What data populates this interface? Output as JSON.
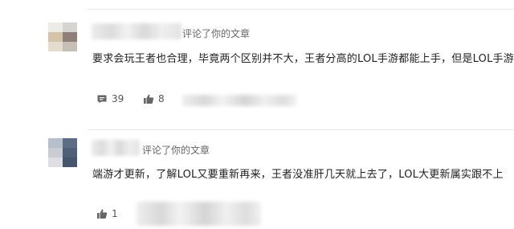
{
  "comments": [
    {
      "action": "评论了你的文章",
      "text": "要求会玩王者也合理，毕竟两个区别并不大，王者分高的LOL手游都能上手，但是LOL手游",
      "reply_count": "39",
      "like_count": "8",
      "avatar_colors": [
        "#ecebe6",
        "#d7d5d2",
        "#d5c3a8",
        "#8e7f78",
        "#e4dccc",
        "#c6bfb6"
      ]
    },
    {
      "action": "评论了你的文章",
      "text": "端游才更新，了解LOL又要重新再来，王者没准肝几天就上去了，LOL大更新属实跟不上",
      "like_count": "1",
      "avatar_colors": [
        "#b6c0cc",
        "#5c6e86",
        "#c9ccd0",
        "#4e5f78",
        "#dde0e3",
        "#44556d"
      ]
    }
  ],
  "icons": {
    "reply": "comment-icon",
    "like": "thumbs-up-icon"
  }
}
